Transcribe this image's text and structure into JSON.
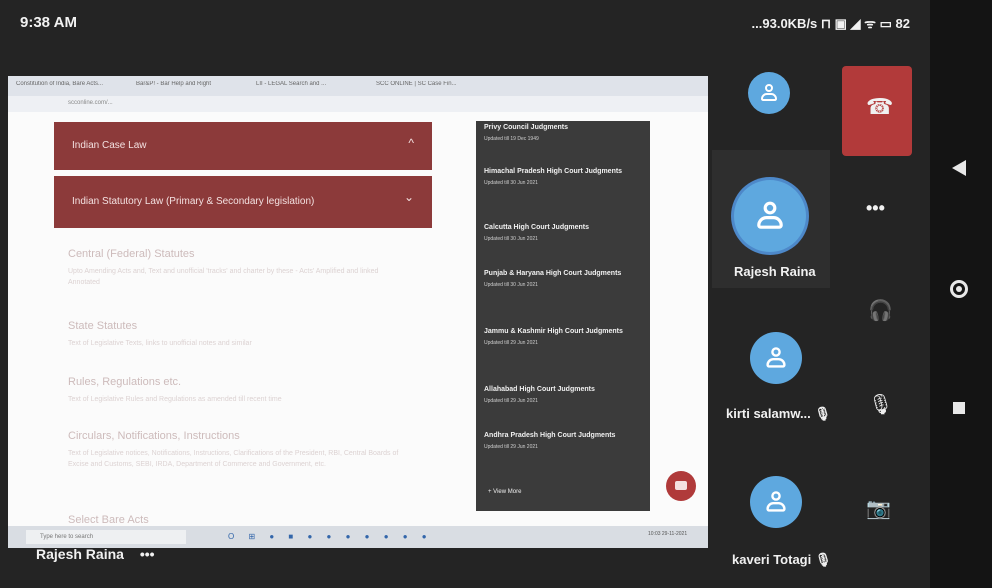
{
  "status": {
    "time": "9:38 AM",
    "system": "...93.0KB/s ⊓ ▣ ◢ ᯤ ▭ 82"
  },
  "browser": {
    "tabs": [
      "Constitution of India, Bare Acts...",
      "Bar&P! - Bar Help and Right",
      "LII - LEGAL Search and ...",
      "SCC ONLINE | SC Case Fin..."
    ],
    "url": "scconline.com/..."
  },
  "accordion": [
    {
      "label": "Indian Case Law",
      "chevron": "^"
    },
    {
      "label": "Indian Statutory Law (Primary & Secondary legislation)",
      "chevron": "⌄"
    }
  ],
  "faded_sections": [
    {
      "title": "Central (Federal) Statutes",
      "desc": "Upto Amending Acts and, Text and unofficial 'tracks' and charter by these - Acts' Amplified and linked Annotated"
    },
    {
      "title": "State Statutes",
      "desc": "Text of Legislative Texts, links to unofficial notes and similar"
    },
    {
      "title": "Rules, Regulations etc.",
      "desc": "Text of Legislative Rules and Regulations as amended till recent time"
    },
    {
      "title": "Circulars, Notifications, Instructions",
      "desc": "Text of Legislative notices, Notifications, Instructions, Clarifications of the President, RBI, Central Boards of Excise and Customs, SEBI, IRDA, Department of Commerce and Government, etc."
    },
    {
      "title": "Select Bare Acts",
      "desc": ""
    }
  ],
  "panel": {
    "items": [
      {
        "name": "Privy Council Judgments",
        "updated": "Updated till 19 Dec 1949"
      },
      {
        "name": "Himachal Pradesh High Court Judgments",
        "updated": "Updated till 30 Jun 2021"
      },
      {
        "name": "Calcutta High Court Judgments",
        "updated": "Updated till 30 Jun 2021"
      },
      {
        "name": "Punjab & Haryana High Court Judgments",
        "updated": "Updated till 30 Jun 2021"
      },
      {
        "name": "Jammu & Kashmir High Court Judgments",
        "updated": "Updated till 29 Jun 2021"
      },
      {
        "name": "Allahabad High Court Judgments",
        "updated": "Updated till 29 Jun 2021"
      },
      {
        "name": "Andhra Pradesh High Court Judgments",
        "updated": "Updated till 29 Jun 2021"
      }
    ],
    "view_more": "+ View More"
  },
  "taskbar": {
    "search": "Type here to search",
    "icons": "O ⊞ ● ■ ● ● ● ● ● ● ●",
    "clock": "10:03 29-11-2021"
  },
  "sharer": {
    "name": "Rajesh Raina",
    "more": "•••"
  },
  "participants": [
    {
      "name": ""
    },
    {
      "name": "Rajesh Raina"
    },
    {
      "name": "kirti salamw... 🎙"
    },
    {
      "name": "kaveri Totagi 🎙"
    }
  ],
  "controls": {
    "end_call": "☎",
    "more": "•••",
    "audio": "🎧",
    "mic": "🎙",
    "camera": "📷"
  },
  "colors": {
    "accordion": "#8c3a3a",
    "panel": "#3b3b3b",
    "avatar": "#5ea8df",
    "end_call": "#b23a3a"
  }
}
